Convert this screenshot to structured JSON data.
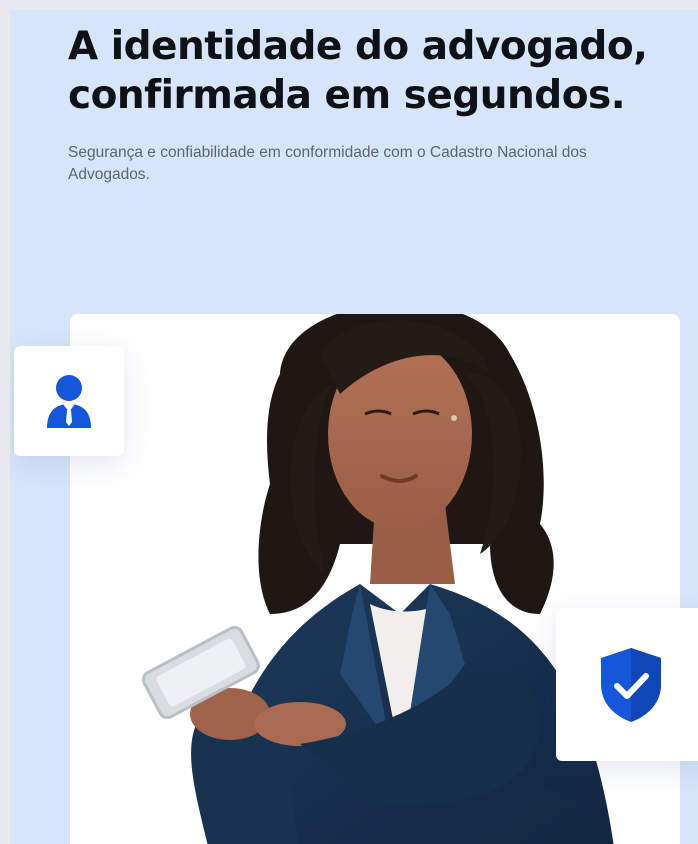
{
  "hero": {
    "headline_line1": "A identidade do advogado,",
    "headline_line2": "confirmada em segundos.",
    "subtitle": "Segurança e confiabilidade em conformidade com o Cadastro Nacional dos Advogados."
  },
  "badges": {
    "user_icon": "lawyer-user-icon",
    "shield_icon": "shield-check-icon"
  },
  "colors": {
    "page_background": "#d7e5fb",
    "accent_blue": "#1457d9",
    "headline": "#0e1116",
    "subtitle": "#5a6473"
  }
}
